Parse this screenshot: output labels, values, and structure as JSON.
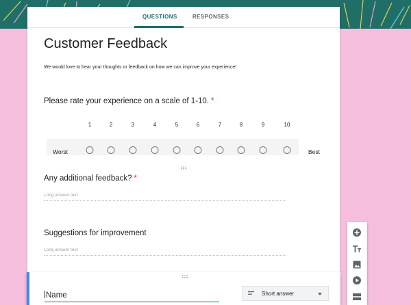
{
  "tabs": [
    {
      "label": "QUESTIONS",
      "active": true
    },
    {
      "label": "RESPONSES",
      "active": false
    }
  ],
  "form": {
    "title": "Customer Feedback",
    "description": "We would love to hear your thoughts or feedback on how we can improve your experience!"
  },
  "questions": [
    {
      "title": "Please rate your experience on a scale of 1-10.",
      "required": true,
      "required_mark": "*",
      "type": "linear-scale",
      "scale_numbers": [
        "1",
        "2",
        "3",
        "4",
        "5",
        "6",
        "7",
        "8",
        "9",
        "10"
      ],
      "low_label": "Worst",
      "high_label": "Best"
    },
    {
      "title": "Any additional feedback?",
      "required": true,
      "required_mark": "*",
      "type": "paragraph",
      "placeholder": "Long answer text"
    },
    {
      "title": "Suggestions for improvement",
      "required": false,
      "type": "paragraph",
      "placeholder": "Long answer text"
    }
  ],
  "active_question": {
    "title_value": "Name",
    "type_label": "Short answer"
  },
  "toolbar": {
    "icons": [
      "add-question-icon",
      "add-title-icon",
      "add-image-icon",
      "add-video-icon",
      "add-section-icon"
    ]
  },
  "colors": {
    "background": "#f6bedd",
    "theme": "#1f6e68",
    "required": "#d93025",
    "active_border": "#4285f4"
  }
}
